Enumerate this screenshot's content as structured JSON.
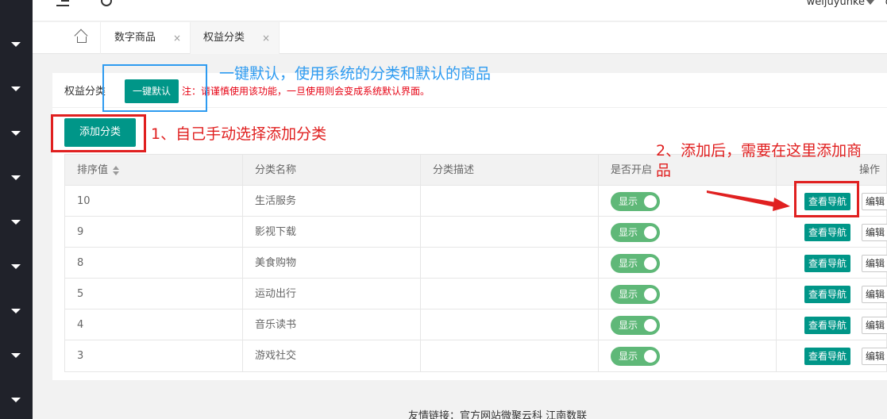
{
  "topbar": {
    "username": "weijuyunke",
    "extra": "q"
  },
  "tabs": [
    {
      "label": "数字商品",
      "close": "×"
    },
    {
      "label": "权益分类",
      "close": "×"
    }
  ],
  "card": {
    "title": "权益分类",
    "default_button": "一键默认",
    "note": "注：请谨慎使用该功能，一旦使用则会变成系统默认界面。",
    "add_button": "添加分类"
  },
  "table": {
    "headers": [
      "排序值",
      "分类名称",
      "分类描述",
      "是否开启",
      "操作"
    ],
    "rows": [
      {
        "sort": "10",
        "name": "生活服务",
        "desc": "",
        "switch": "显示",
        "nav": "查看导航",
        "edit": "编辑"
      },
      {
        "sort": "9",
        "name": "影视下载",
        "desc": "",
        "switch": "显示",
        "nav": "查看导航",
        "edit": "编辑"
      },
      {
        "sort": "8",
        "name": "美食购物",
        "desc": "",
        "switch": "显示",
        "nav": "查看导航",
        "edit": "编辑"
      },
      {
        "sort": "5",
        "name": "运动出行",
        "desc": "",
        "switch": "显示",
        "nav": "查看导航",
        "edit": "编辑"
      },
      {
        "sort": "4",
        "name": "音乐读书",
        "desc": "",
        "switch": "显示",
        "nav": "查看导航",
        "edit": "编辑"
      },
      {
        "sort": "3",
        "name": "游戏社交",
        "desc": "",
        "switch": "显示",
        "nav": "查看导航",
        "edit": "编辑"
      }
    ]
  },
  "footer": {
    "text": "友情链接：官方网站微聚云科    江南数联"
  },
  "annotations": {
    "one_click": "一键默认，使用系统的分类和默认的商品",
    "manual": "1、自己手动选择添加分类",
    "after_add_line1": "2、添加后，需要在这里添加商",
    "after_add_line2": "品"
  },
  "colors": {
    "primary": "#009688",
    "switch_on": "#5fb878",
    "sidebar": "#20222a",
    "annotation_red": "#e60012",
    "annotation_blue": "#2e9bf0"
  }
}
